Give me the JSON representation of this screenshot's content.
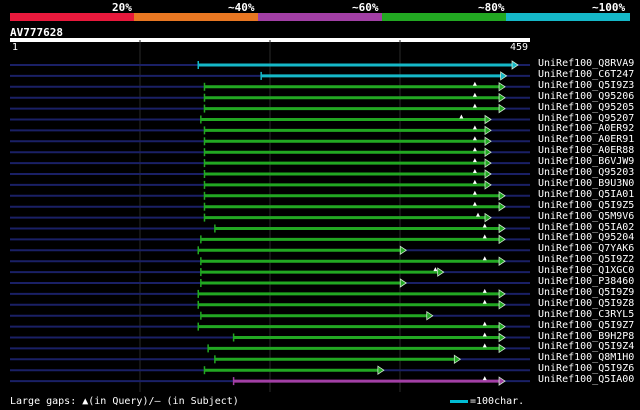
{
  "scale": {
    "labels": [
      "20%",
      "~40%",
      "~60%",
      "~80%",
      "~100%"
    ],
    "colors": [
      "#e8193c",
      "#e87722",
      "#a23fa5",
      "#22a822",
      "#15b8c8"
    ]
  },
  "query": {
    "id": "AV777628",
    "start": "1",
    "end": "459",
    "length": 459
  },
  "colors": {
    "green": "#22a822",
    "cyan": "#15b8c8",
    "magenta": "#a23fa5",
    "navy": "#1a2066",
    "grid": "#2a2a2a"
  },
  "hits": [
    {
      "name": "UniRef100_Q8RVA9",
      "color": "cyan",
      "s": 0.362,
      "e": 0.977,
      "gaps": []
    },
    {
      "name": "UniRef100_C6T247",
      "color": "cyan",
      "s": 0.483,
      "e": 0.955,
      "gaps": []
    },
    {
      "name": "UniRef100_Q5I9Z3",
      "color": "green",
      "s": 0.374,
      "e": 0.952,
      "gaps": [
        0.894
      ]
    },
    {
      "name": "UniRef100_Q95206",
      "color": "green",
      "s": 0.374,
      "e": 0.952,
      "gaps": [
        0.894
      ]
    },
    {
      "name": "UniRef100_Q95205",
      "color": "green",
      "s": 0.374,
      "e": 0.952,
      "gaps": [
        0.894
      ]
    },
    {
      "name": "UniRef100_Q95207",
      "color": "green",
      "s": 0.367,
      "e": 0.925,
      "gaps": [
        0.868
      ]
    },
    {
      "name": "UniRef100_A0ER92",
      "color": "green",
      "s": 0.374,
      "e": 0.925,
      "gaps": [
        0.894
      ]
    },
    {
      "name": "UniRef100_A0ER91",
      "color": "green",
      "s": 0.374,
      "e": 0.925,
      "gaps": [
        0.894
      ]
    },
    {
      "name": "UniRef100_A0ER88",
      "color": "green",
      "s": 0.374,
      "e": 0.925,
      "gaps": [
        0.894
      ]
    },
    {
      "name": "UniRef100_B6VJW9",
      "color": "green",
      "s": 0.374,
      "e": 0.925,
      "gaps": [
        0.894
      ]
    },
    {
      "name": "UniRef100_Q95203",
      "color": "green",
      "s": 0.374,
      "e": 0.925,
      "gaps": [
        0.894
      ]
    },
    {
      "name": "UniRef100_B9U3N0",
      "color": "green",
      "s": 0.374,
      "e": 0.925,
      "gaps": [
        0.894
      ]
    },
    {
      "name": "UniRef100_Q5IA01",
      "color": "green",
      "s": 0.374,
      "e": 0.952,
      "gaps": [
        0.894
      ]
    },
    {
      "name": "UniRef100_Q5I9Z5",
      "color": "green",
      "s": 0.374,
      "e": 0.952,
      "gaps": [
        0.894
      ]
    },
    {
      "name": "UniRef100_Q5M9V6",
      "color": "green",
      "s": 0.374,
      "e": 0.925,
      "gaps": [
        0.9
      ]
    },
    {
      "name": "UniRef100_Q5IA02",
      "color": "green",
      "s": 0.394,
      "e": 0.952,
      "gaps": [
        0.913
      ]
    },
    {
      "name": "UniRef100_Q95204",
      "color": "green",
      "s": 0.367,
      "e": 0.952,
      "gaps": [
        0.913
      ]
    },
    {
      "name": "UniRef100_Q7YAK6",
      "color": "green",
      "s": 0.362,
      "e": 0.762,
      "gaps": []
    },
    {
      "name": "UniRef100_Q5I9Z2",
      "color": "green",
      "s": 0.367,
      "e": 0.952,
      "gaps": [
        0.913
      ]
    },
    {
      "name": "UniRef100_Q1XGC0",
      "color": "green",
      "s": 0.367,
      "e": 0.834,
      "gaps": [
        0.818
      ]
    },
    {
      "name": "UniRef100_P38460",
      "color": "green",
      "s": 0.367,
      "e": 0.762,
      "gaps": []
    },
    {
      "name": "UniRef100_Q5I9Z9",
      "color": "green",
      "s": 0.362,
      "e": 0.952,
      "gaps": [
        0.913
      ]
    },
    {
      "name": "UniRef100_Q5I9Z8",
      "color": "green",
      "s": 0.362,
      "e": 0.952,
      "gaps": [
        0.913
      ]
    },
    {
      "name": "UniRef100_C3RYL5",
      "color": "green",
      "s": 0.367,
      "e": 0.813,
      "gaps": []
    },
    {
      "name": "UniRef100_Q5I9Z7",
      "color": "green",
      "s": 0.362,
      "e": 0.952,
      "gaps": [
        0.913
      ]
    },
    {
      "name": "UniRef100_B9H2P8",
      "color": "green",
      "s": 0.43,
      "e": 0.952,
      "gaps": [
        0.913
      ]
    },
    {
      "name": "UniRef100_Q5I9Z4",
      "color": "green",
      "s": 0.381,
      "e": 0.952,
      "gaps": [
        0.913
      ]
    },
    {
      "name": "UniRef100_Q8M1H0",
      "color": "green",
      "s": 0.394,
      "e": 0.866,
      "gaps": []
    },
    {
      "name": "UniRef100_Q5I9Z6",
      "color": "green",
      "s": 0.374,
      "e": 0.719,
      "gaps": []
    },
    {
      "name": "UniRef100_Q5IA00",
      "color": "magenta",
      "s": 0.43,
      "e": 0.952,
      "gaps": [
        0.913
      ]
    }
  ],
  "footer": {
    "left": "Large gaps: ▲(in Query)/– (in Subject)",
    "right": "=100char."
  }
}
